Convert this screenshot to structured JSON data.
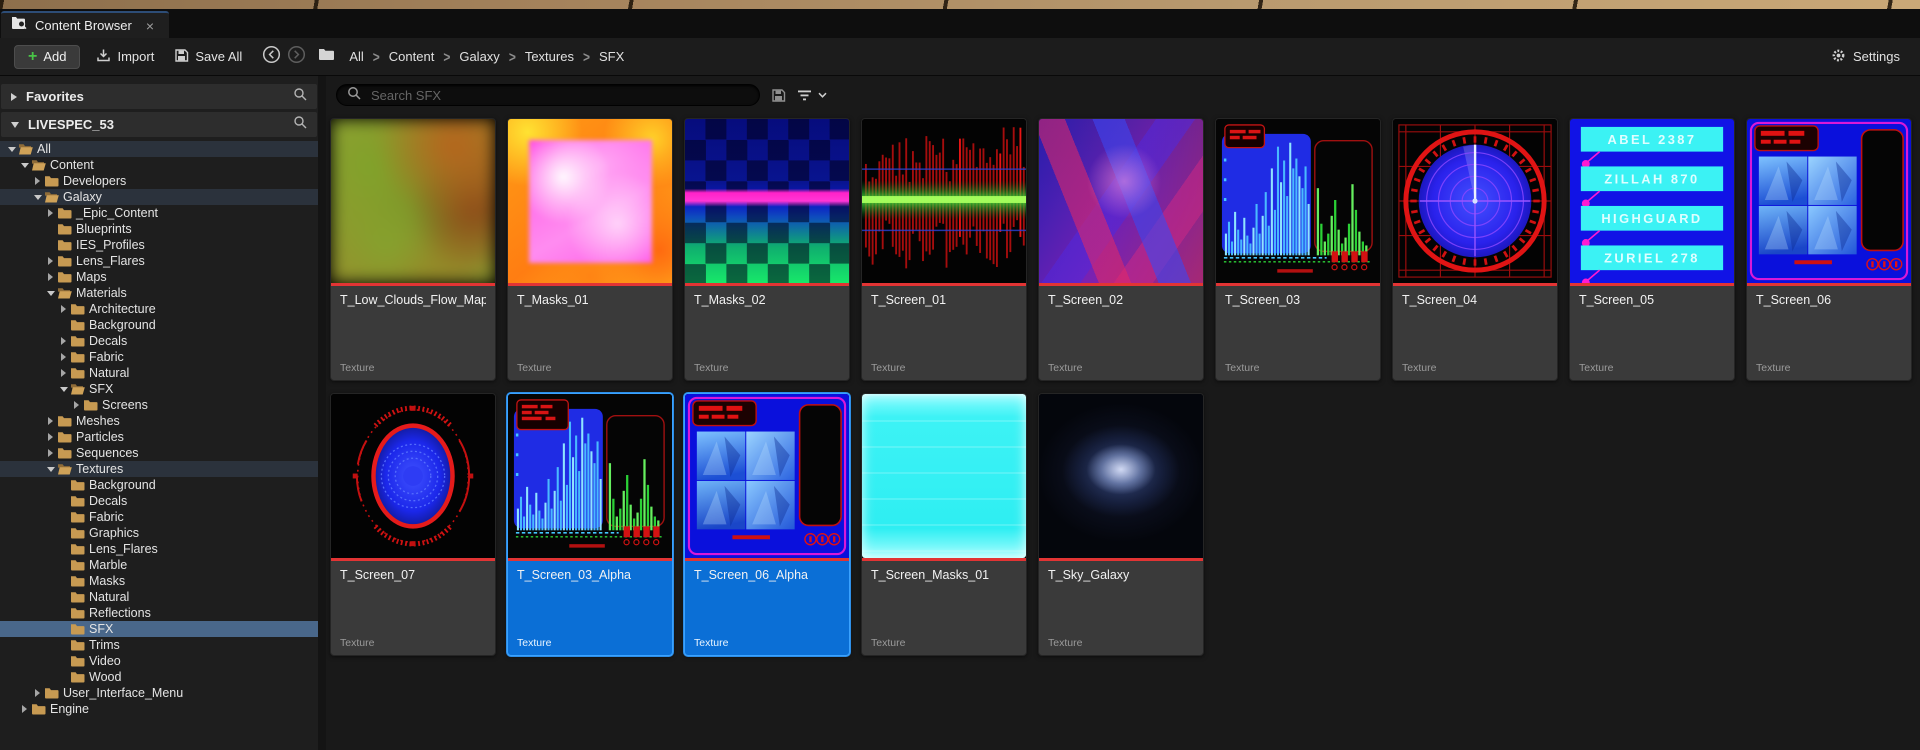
{
  "tab": {
    "title": "Content Browser",
    "close": "×"
  },
  "toolbar": {
    "add_label": "Add",
    "import_label": "Import",
    "save_all_label": "Save All",
    "settings_label": "Settings"
  },
  "breadcrumb": {
    "items": [
      "All",
      "Content",
      "Galaxy",
      "Textures",
      "SFX"
    ]
  },
  "sidebar": {
    "favorites_label": "Favorites",
    "collection_label": "LIVESPEC_53",
    "tree": [
      {
        "label": "All",
        "level": 0,
        "expander": "open",
        "folder": "open",
        "state": "hl"
      },
      {
        "label": "Content",
        "level": 1,
        "expander": "open",
        "folder": "open",
        "state": ""
      },
      {
        "label": "Developers",
        "level": 2,
        "expander": "closed",
        "folder": "closed",
        "state": ""
      },
      {
        "label": "Galaxy",
        "level": 2,
        "expander": "open",
        "folder": "open",
        "state": "hl"
      },
      {
        "label": "_Epic_Content",
        "level": 3,
        "expander": "closed",
        "folder": "closed",
        "state": ""
      },
      {
        "label": "Blueprints",
        "level": 3,
        "expander": "none",
        "folder": "closed",
        "state": ""
      },
      {
        "label": "IES_Profiles",
        "level": 3,
        "expander": "none",
        "folder": "closed",
        "state": ""
      },
      {
        "label": "Lens_Flares",
        "level": 3,
        "expander": "closed",
        "folder": "closed",
        "state": ""
      },
      {
        "label": "Maps",
        "level": 3,
        "expander": "closed",
        "folder": "closed",
        "state": ""
      },
      {
        "label": "Materials",
        "level": 3,
        "expander": "open",
        "folder": "open",
        "state": ""
      },
      {
        "label": "Architecture",
        "level": 4,
        "expander": "closed",
        "folder": "closed",
        "state": ""
      },
      {
        "label": "Background",
        "level": 4,
        "expander": "none",
        "folder": "closed",
        "state": ""
      },
      {
        "label": "Decals",
        "level": 4,
        "expander": "closed",
        "folder": "closed",
        "state": ""
      },
      {
        "label": "Fabric",
        "level": 4,
        "expander": "closed",
        "folder": "closed",
        "state": ""
      },
      {
        "label": "Natural",
        "level": 4,
        "expander": "closed",
        "folder": "closed",
        "state": ""
      },
      {
        "label": "SFX",
        "level": 4,
        "expander": "open",
        "folder": "open",
        "state": ""
      },
      {
        "label": "Screens",
        "level": 5,
        "expander": "closed",
        "folder": "closed",
        "state": ""
      },
      {
        "label": "Meshes",
        "level": 3,
        "expander": "closed",
        "folder": "closed",
        "state": ""
      },
      {
        "label": "Particles",
        "level": 3,
        "expander": "closed",
        "folder": "closed",
        "state": ""
      },
      {
        "label": "Sequences",
        "level": 3,
        "expander": "closed",
        "folder": "closed",
        "state": ""
      },
      {
        "label": "Textures",
        "level": 3,
        "expander": "open",
        "folder": "open",
        "state": "hl"
      },
      {
        "label": "Background",
        "level": 4,
        "expander": "none",
        "folder": "closed",
        "state": ""
      },
      {
        "label": "Decals",
        "level": 4,
        "expander": "none",
        "folder": "closed",
        "state": ""
      },
      {
        "label": "Fabric",
        "level": 4,
        "expander": "none",
        "folder": "closed",
        "state": ""
      },
      {
        "label": "Graphics",
        "level": 4,
        "expander": "none",
        "folder": "closed",
        "state": ""
      },
      {
        "label": "Lens_Flares",
        "level": 4,
        "expander": "none",
        "folder": "closed",
        "state": ""
      },
      {
        "label": "Marble",
        "level": 4,
        "expander": "none",
        "folder": "closed",
        "state": ""
      },
      {
        "label": "Masks",
        "level": 4,
        "expander": "none",
        "folder": "closed",
        "state": ""
      },
      {
        "label": "Natural",
        "level": 4,
        "expander": "none",
        "folder": "closed",
        "state": ""
      },
      {
        "label": "Reflections",
        "level": 4,
        "expander": "none",
        "folder": "closed",
        "state": ""
      },
      {
        "label": "SFX",
        "level": 4,
        "expander": "none",
        "folder": "closed",
        "state": "selected"
      },
      {
        "label": "Trims",
        "level": 4,
        "expander": "none",
        "folder": "closed",
        "state": ""
      },
      {
        "label": "Video",
        "level": 4,
        "expander": "none",
        "folder": "closed",
        "state": ""
      },
      {
        "label": "Wood",
        "level": 4,
        "expander": "none",
        "folder": "closed",
        "state": ""
      },
      {
        "label": "User_Interface_Menu",
        "level": 2,
        "expander": "closed",
        "folder": "closed",
        "state": ""
      },
      {
        "label": "Engine",
        "level": 1,
        "expander": "closed",
        "folder": "closed",
        "state": ""
      }
    ]
  },
  "search": {
    "placeholder": "Search SFX"
  },
  "grid": {
    "type_label": "Texture",
    "assets": [
      {
        "name": "T_Low_Clouds_Flow_Map",
        "thumb": "flow_map",
        "selected": false
      },
      {
        "name": "T_Masks_01",
        "thumb": "masks_01",
        "selected": false
      },
      {
        "name": "T_Masks_02",
        "thumb": "masks_02",
        "selected": false
      },
      {
        "name": "T_Screen_01",
        "thumb": "screen_01",
        "selected": false
      },
      {
        "name": "T_Screen_02",
        "thumb": "screen_02",
        "selected": false
      },
      {
        "name": "T_Screen_03",
        "thumb": "screen_03",
        "selected": false
      },
      {
        "name": "T_Screen_04",
        "thumb": "screen_04",
        "selected": false
      },
      {
        "name": "T_Screen_05",
        "thumb": "screen_05",
        "selected": false,
        "labels": [
          "ABEL 2387",
          "ZILLAH 870",
          "HIGHGUARD",
          "ZURIEL 278"
        ]
      },
      {
        "name": "T_Screen_06",
        "thumb": "screen_06",
        "selected": false
      },
      {
        "name": "T_Screen_07",
        "thumb": "screen_07",
        "selected": false
      },
      {
        "name": "T_Screen_03_Alpha",
        "thumb": "screen_03_big",
        "selected": true
      },
      {
        "name": "T_Screen_06_Alpha",
        "thumb": "screen_06",
        "selected": true
      },
      {
        "name": "T_Screen_Masks_01",
        "thumb": "screen_masks",
        "selected": false
      },
      {
        "name": "T_Sky_Galaxy",
        "thumb": "sky_galaxy",
        "selected": false
      }
    ]
  },
  "colors": {
    "selection_blue": "#0b6fd6",
    "tree_selection": "#49678a",
    "texture_bar_red": "#e23434",
    "folder_tan": "#c79a52",
    "add_plus_green": "#49c447"
  }
}
